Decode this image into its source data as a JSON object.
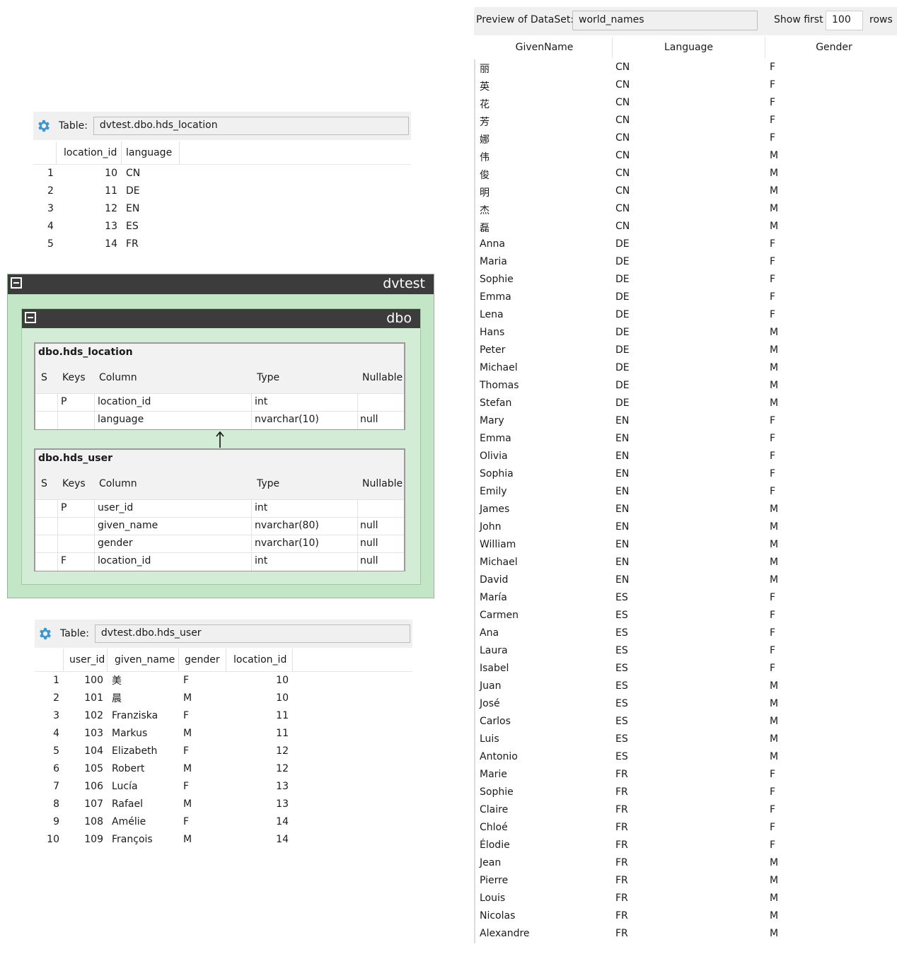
{
  "location_table": {
    "label": "Table:",
    "name": "dvtest.dbo.hds_location",
    "columns": [
      "location_id",
      "language"
    ],
    "rows": [
      {
        "n": "1",
        "location_id": "10",
        "language": "CN"
      },
      {
        "n": "2",
        "location_id": "11",
        "language": "DE"
      },
      {
        "n": "3",
        "location_id": "12",
        "language": "EN"
      },
      {
        "n": "4",
        "location_id": "13",
        "language": "ES"
      },
      {
        "n": "5",
        "location_id": "14",
        "language": "FR"
      }
    ]
  },
  "user_table": {
    "label": "Table:",
    "name": "dvtest.dbo.hds_user",
    "columns": [
      "user_id",
      "given_name",
      "gender",
      "location_id"
    ],
    "rows": [
      {
        "n": "1",
        "user_id": "100",
        "given_name": "美",
        "gender": "F",
        "location_id": "10"
      },
      {
        "n": "2",
        "user_id": "101",
        "given_name": "晨",
        "gender": "M",
        "location_id": "10"
      },
      {
        "n": "3",
        "user_id": "102",
        "given_name": "Franziska",
        "gender": "F",
        "location_id": "11"
      },
      {
        "n": "4",
        "user_id": "103",
        "given_name": "Markus",
        "gender": "M",
        "location_id": "11"
      },
      {
        "n": "5",
        "user_id": "104",
        "given_name": "Elizabeth",
        "gender": "F",
        "location_id": "12"
      },
      {
        "n": "6",
        "user_id": "105",
        "given_name": "Robert",
        "gender": "M",
        "location_id": "12"
      },
      {
        "n": "7",
        "user_id": "106",
        "given_name": "Lucía",
        "gender": "F",
        "location_id": "13"
      },
      {
        "n": "8",
        "user_id": "107",
        "given_name": "Rafael",
        "gender": "M",
        "location_id": "13"
      },
      {
        "n": "9",
        "user_id": "108",
        "given_name": "Amélie",
        "gender": "F",
        "location_id": "14"
      },
      {
        "n": "10",
        "user_id": "109",
        "given_name": "François",
        "gender": "M",
        "location_id": "14"
      }
    ]
  },
  "schema": {
    "database": "dvtest",
    "schema_name": "dbo",
    "header": {
      "s": "S",
      "keys": "Keys",
      "column": "Column",
      "type": "Type",
      "nullable": "Nullable"
    },
    "entities": [
      {
        "name": "dbo.hds_location",
        "columns": [
          {
            "key": "P",
            "column": "location_id",
            "type": "int",
            "nullable": ""
          },
          {
            "key": "",
            "column": "language",
            "type": "nvarchar(10)",
            "nullable": "null"
          }
        ]
      },
      {
        "name": "dbo.hds_user",
        "columns": [
          {
            "key": "P",
            "column": "user_id",
            "type": "int",
            "nullable": ""
          },
          {
            "key": "",
            "column": "given_name",
            "type": "nvarchar(80)",
            "nullable": "null"
          },
          {
            "key": "",
            "column": "gender",
            "type": "nvarchar(10)",
            "nullable": "null"
          },
          {
            "key": "F",
            "column": "location_id",
            "type": "int",
            "nullable": "null"
          }
        ]
      }
    ]
  },
  "preview": {
    "label": "Preview of DataSet:",
    "dataset": "world_names",
    "show_first_label": "Show first",
    "show_first_value": "100",
    "rows_label": "rows",
    "columns": [
      "GivenName",
      "Language",
      "Gender"
    ],
    "rows": [
      [
        "丽",
        "CN",
        "F"
      ],
      [
        "英",
        "CN",
        "F"
      ],
      [
        "花",
        "CN",
        "F"
      ],
      [
        "芳",
        "CN",
        "F"
      ],
      [
        "娜",
        "CN",
        "F"
      ],
      [
        "伟",
        "CN",
        "M"
      ],
      [
        "俊",
        "CN",
        "M"
      ],
      [
        "明",
        "CN",
        "M"
      ],
      [
        "杰",
        "CN",
        "M"
      ],
      [
        "磊",
        "CN",
        "M"
      ],
      [
        "Anna",
        "DE",
        "F"
      ],
      [
        "Maria",
        "DE",
        "F"
      ],
      [
        "Sophie",
        "DE",
        "F"
      ],
      [
        "Emma",
        "DE",
        "F"
      ],
      [
        "Lena",
        "DE",
        "F"
      ],
      [
        "Hans",
        "DE",
        "M"
      ],
      [
        "Peter",
        "DE",
        "M"
      ],
      [
        "Michael",
        "DE",
        "M"
      ],
      [
        "Thomas",
        "DE",
        "M"
      ],
      [
        "Stefan",
        "DE",
        "M"
      ],
      [
        "Mary",
        "EN",
        "F"
      ],
      [
        "Emma",
        "EN",
        "F"
      ],
      [
        "Olivia",
        "EN",
        "F"
      ],
      [
        "Sophia",
        "EN",
        "F"
      ],
      [
        "Emily",
        "EN",
        "F"
      ],
      [
        "James",
        "EN",
        "M"
      ],
      [
        "John",
        "EN",
        "M"
      ],
      [
        "William",
        "EN",
        "M"
      ],
      [
        "Michael",
        "EN",
        "M"
      ],
      [
        "David",
        "EN",
        "M"
      ],
      [
        "María",
        "ES",
        "F"
      ],
      [
        "Carmen",
        "ES",
        "F"
      ],
      [
        "Ana",
        "ES",
        "F"
      ],
      [
        "Laura",
        "ES",
        "F"
      ],
      [
        "Isabel",
        "ES",
        "F"
      ],
      [
        "Juan",
        "ES",
        "M"
      ],
      [
        "José",
        "ES",
        "M"
      ],
      [
        "Carlos",
        "ES",
        "M"
      ],
      [
        "Luis",
        "ES",
        "M"
      ],
      [
        "Antonio",
        "ES",
        "M"
      ],
      [
        "Marie",
        "FR",
        "F"
      ],
      [
        "Sophie",
        "FR",
        "F"
      ],
      [
        "Claire",
        "FR",
        "F"
      ],
      [
        "Chloé",
        "FR",
        "F"
      ],
      [
        "Élodie",
        "FR",
        "F"
      ],
      [
        "Jean",
        "FR",
        "M"
      ],
      [
        "Pierre",
        "FR",
        "M"
      ],
      [
        "Louis",
        "FR",
        "M"
      ],
      [
        "Nicolas",
        "FR",
        "M"
      ],
      [
        "Alexandre",
        "FR",
        "M"
      ]
    ]
  },
  "colors": {
    "gear": "#3a97d4",
    "schema_bg": "#c3e6c6",
    "band": "#3c3c3c"
  },
  "icons": {
    "settings": "gear-icon",
    "collapse": "collapse-icon",
    "relation": "arrow-up-icon"
  }
}
